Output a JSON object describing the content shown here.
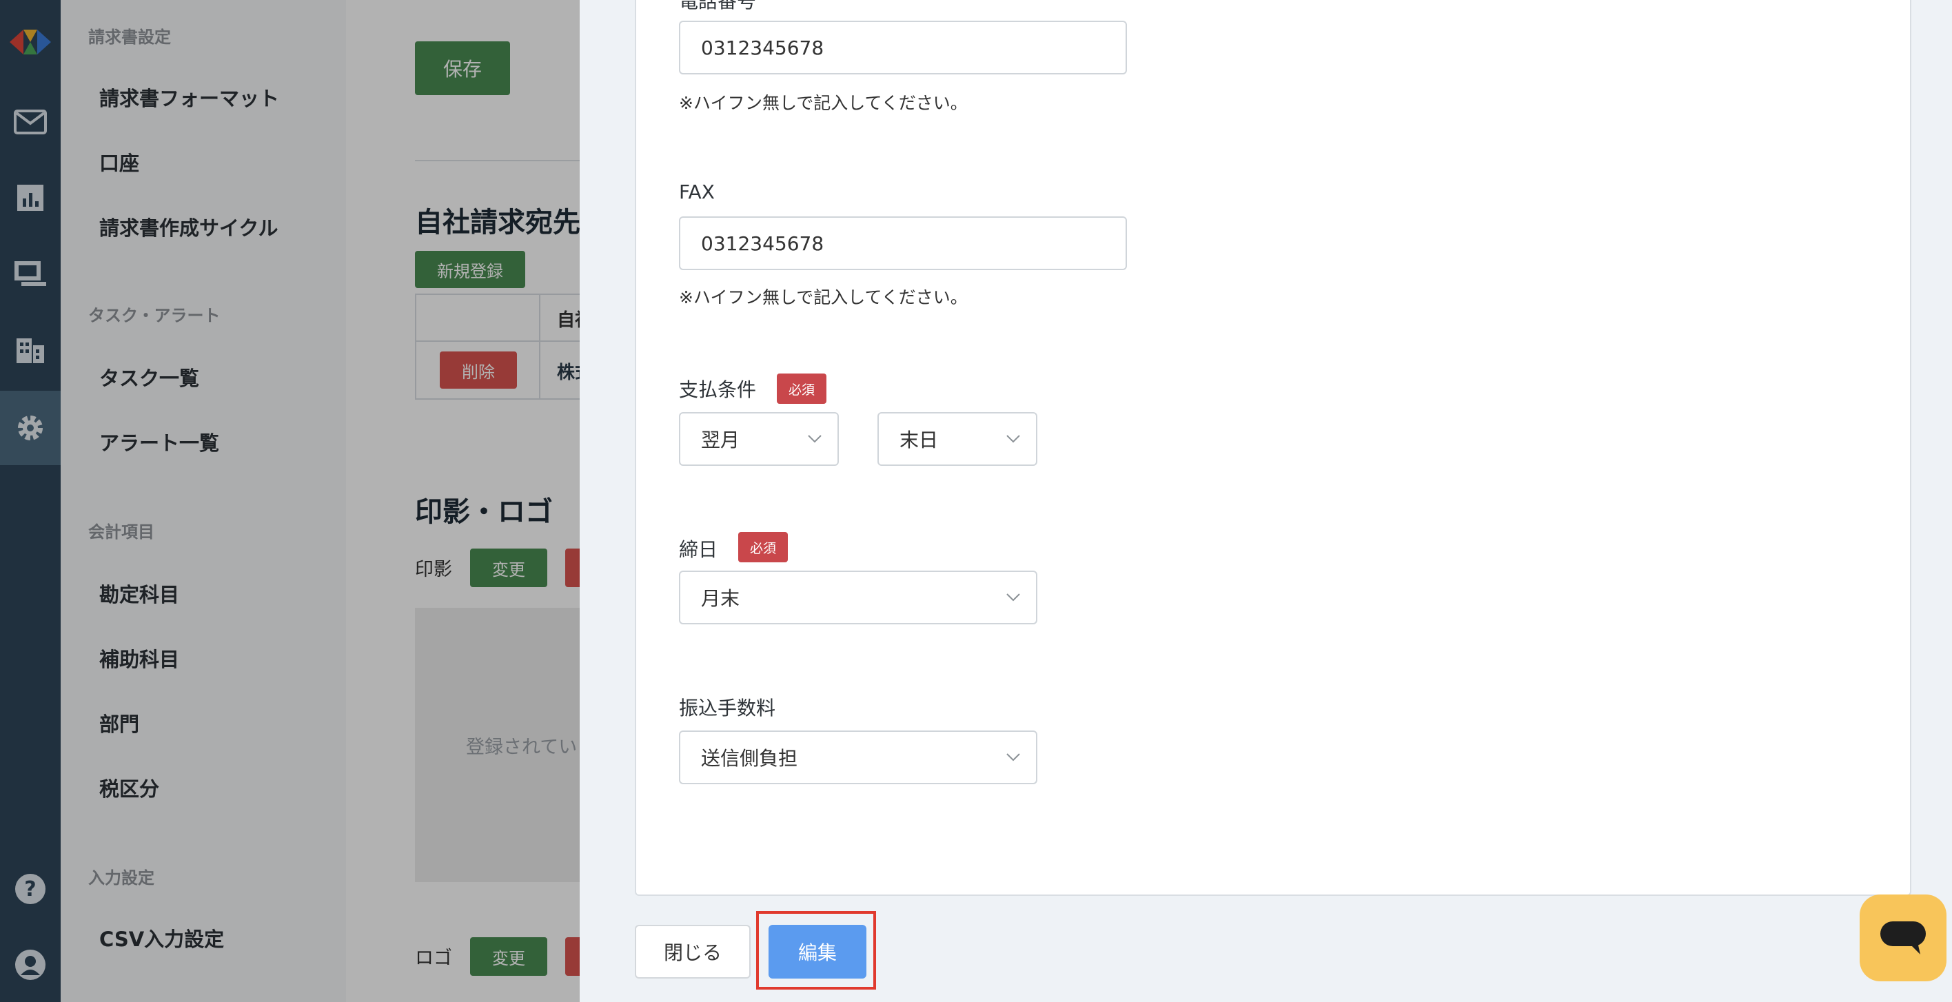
{
  "sidebar": {
    "sections": [
      {
        "title": "請求書設定",
        "items": [
          "請求書フォーマット",
          "口座",
          "請求書作成サイクル"
        ]
      },
      {
        "title": "タスク・アラート",
        "items": [
          "タスク一覧",
          "アラート一覧"
        ]
      },
      {
        "title": "会計項目",
        "items": [
          "勘定科目",
          "補助科目",
          "部門",
          "税区分"
        ]
      },
      {
        "title": "入力設定",
        "items": [
          "CSV入力設定"
        ]
      }
    ]
  },
  "main": {
    "save_label": "保存",
    "company_title": "自社請求宛先",
    "new_label": "新規登録",
    "table_header_partial": "自社",
    "delete_label": "削除",
    "row_partial": "株式",
    "seal_title": "印影・ロゴ",
    "seal_label": "印影",
    "change_label": "変更",
    "not_registered_partial": "登録されてい",
    "logo_label": "ロゴ"
  },
  "drawer": {
    "phone": {
      "label_partial": "電話番号",
      "value": "0312345678",
      "note": "※ハイフン無しで記入してください。"
    },
    "fax": {
      "label": "FAX",
      "value": "0312345678",
      "note": "※ハイフン無しで記入してください。"
    },
    "payment_terms": {
      "label": "支払条件",
      "required": "必須",
      "month": "翌月",
      "day": "末日"
    },
    "closing_day": {
      "label": "締日",
      "required": "必須",
      "value": "月末"
    },
    "transfer_fee": {
      "label": "振込手数料",
      "value": "送信側負担"
    },
    "close_label": "閉じる",
    "edit_label": "編集"
  },
  "colors": {
    "rail": "#2f4659",
    "accent_green": "#4a8c52",
    "danger": "#d9534f",
    "primary": "#5b9bef",
    "highlight": "#e03a2e",
    "chat": "#f8c55a"
  }
}
